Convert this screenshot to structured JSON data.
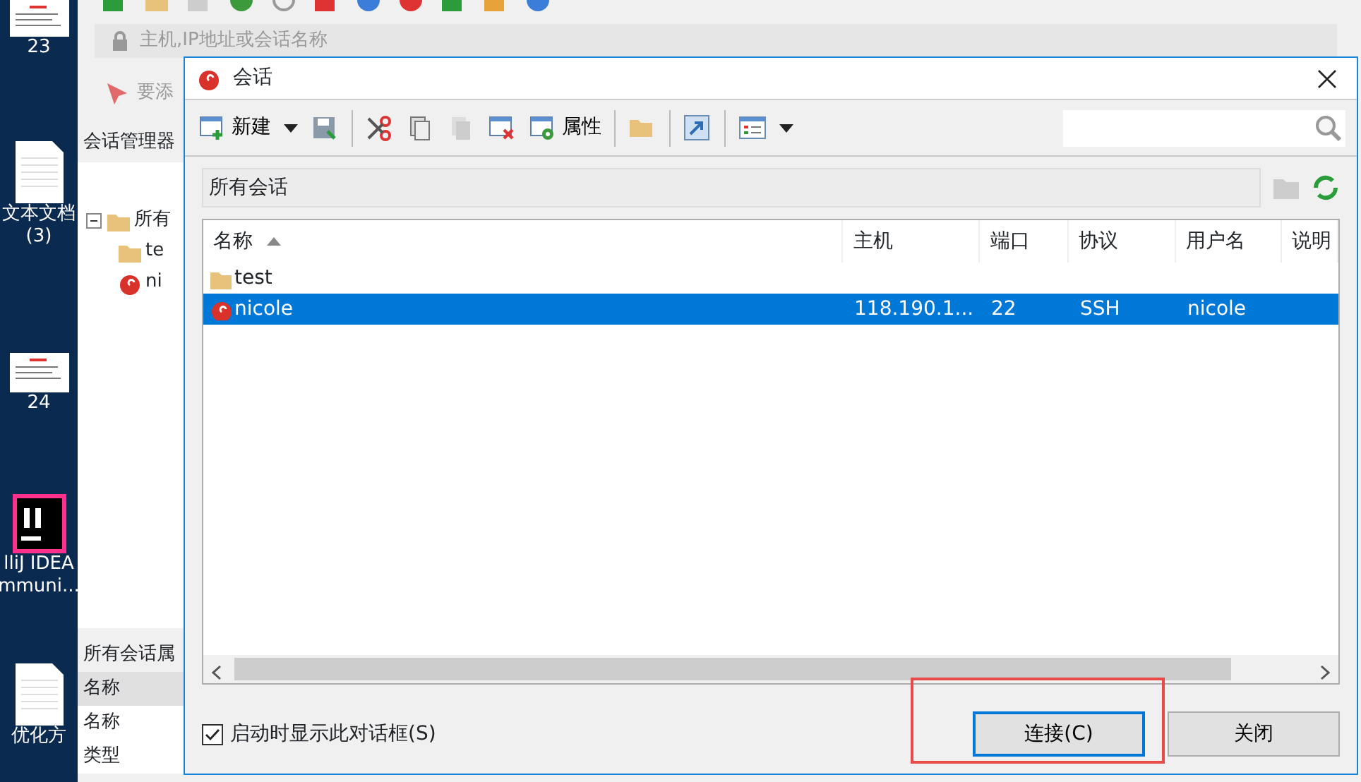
{
  "desktop": {
    "icons": [
      {
        "kind": "slide",
        "lines": [
          "23"
        ]
      },
      {
        "kind": "document",
        "lines": [
          "文本文档",
          "(3)"
        ]
      },
      {
        "kind": "slide",
        "lines": [
          "24"
        ]
      },
      {
        "kind": "ide",
        "lines": [
          "lliJ IDEA",
          "mmuni..."
        ]
      },
      {
        "kind": "document",
        "lines": [
          "优化方"
        ]
      }
    ]
  },
  "background_app": {
    "address_placeholder": "主机,IP地址或会话名称",
    "bookmark_hint": "要添",
    "session_manager": {
      "title": "会话管理器",
      "tree": [
        {
          "label": "所有",
          "kind": "folder",
          "expanded": true,
          "children": [
            {
              "label": "te",
              "kind": "folder"
            },
            {
              "label": "ni",
              "kind": "session"
            }
          ]
        }
      ]
    },
    "properties": {
      "title": "所有会话属",
      "header": "名称",
      "rows": [
        "名称",
        "类型"
      ]
    }
  },
  "dialog": {
    "title": "会话",
    "toolbar": [
      {
        "kind": "new",
        "label": "新建"
      },
      {
        "kind": "caret"
      },
      {
        "kind": "save"
      },
      {
        "kind": "sep"
      },
      {
        "kind": "cut"
      },
      {
        "kind": "copy"
      },
      {
        "kind": "paste"
      },
      {
        "kind": "delete"
      },
      {
        "kind": "properties",
        "label": "属性"
      },
      {
        "kind": "sep"
      },
      {
        "kind": "folder"
      },
      {
        "kind": "sep"
      },
      {
        "kind": "shortcut"
      },
      {
        "kind": "sep"
      },
      {
        "kind": "view"
      },
      {
        "kind": "caret"
      }
    ],
    "path": "所有会话",
    "columns": [
      {
        "label": "名称",
        "sorted": true
      },
      {
        "label": "主机",
        "sorted": false
      },
      {
        "label": "端口",
        "sorted": false
      },
      {
        "label": "协议",
        "sorted": false
      },
      {
        "label": "用户名",
        "sorted": false
      },
      {
        "label": "说明",
        "sorted": false
      }
    ],
    "rows": [
      {
        "kind": "folder",
        "selected": false,
        "cells": [
          "test"
        ]
      },
      {
        "kind": "session",
        "selected": true,
        "cells": [
          "nicole",
          "118.190.1...",
          "22",
          "SSH",
          "nicole"
        ]
      }
    ],
    "checkbox": {
      "label": "启动时显示此对话框(S)",
      "checked": true
    },
    "buttons": [
      {
        "label": "连接(C)",
        "default": true,
        "highlighted": true
      },
      {
        "label": "关闭",
        "default": false,
        "highlighted": false
      }
    ]
  }
}
